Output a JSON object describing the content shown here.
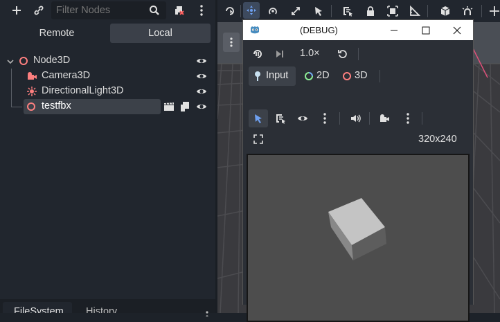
{
  "scene_toolbar": {
    "add_icon": "plus-icon",
    "link_icon": "link-icon",
    "filter_placeholder": "Filter Nodes",
    "search_icon": "search-icon",
    "script_icon": "script-icon",
    "menu_icon": "kebab-icon"
  },
  "remote_local": {
    "remote": "Remote",
    "local": "Local",
    "active": "Local"
  },
  "tree": {
    "root": {
      "label": "Node3D",
      "icon": "node3d-icon",
      "color": "#fc7f7f"
    },
    "children": [
      {
        "label": "Camera3D",
        "icon": "camera-icon",
        "color": "#fc7f7f"
      },
      {
        "label": "DirectionalLight3D",
        "icon": "light-icon",
        "color": "#fc7f7f"
      },
      {
        "label": "testfbx",
        "icon": "node3d-icon",
        "color": "#fc7f7f",
        "selected": true
      }
    ]
  },
  "bottom_tabs": {
    "filesystem": "FileSystem",
    "history": "History"
  },
  "debug_window": {
    "title": "(DEBUG)",
    "speed": "1.0×",
    "input_label": "Input",
    "mode_2d": "2D",
    "mode_3d": "3D",
    "resolution": "320x240"
  },
  "colors": {
    "accent": "#6ea0f0",
    "selected_bg": "#3c4149",
    "node_red": "#fc7f7f",
    "circle_2d_green": "#8eef97"
  }
}
